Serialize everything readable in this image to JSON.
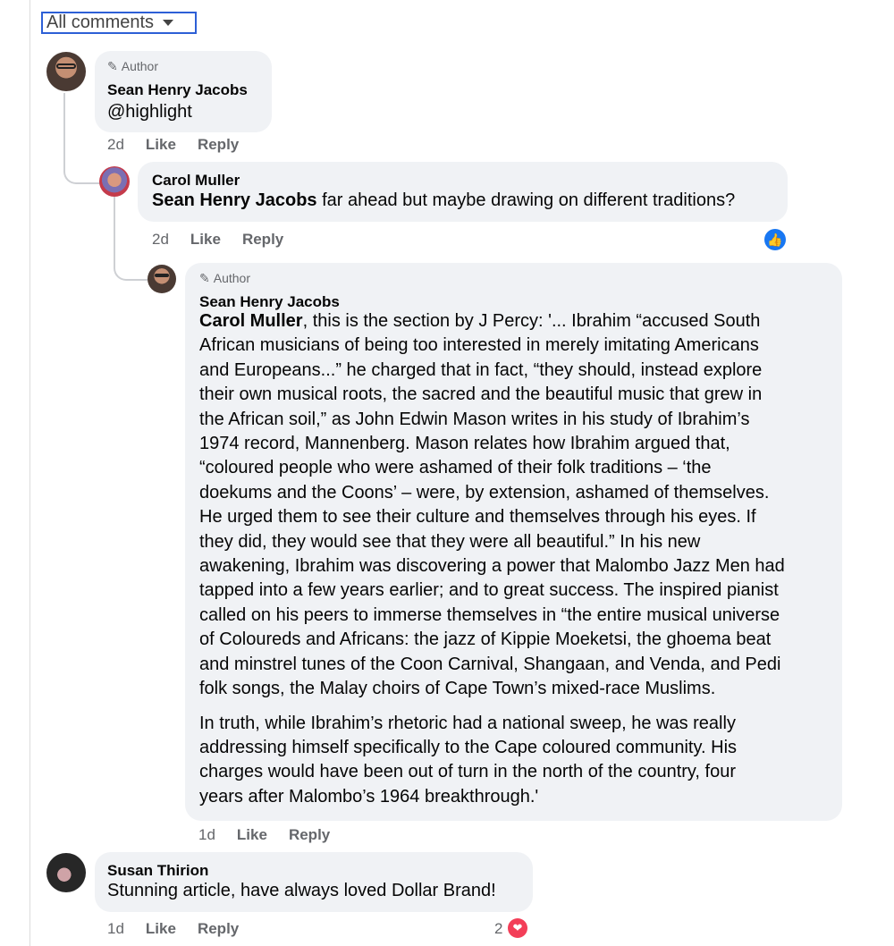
{
  "filter": {
    "label": "All comments"
  },
  "comments": [
    {
      "badge": "Author",
      "author": "Sean Henry Jacobs",
      "text": "@highlight",
      "time": "2d",
      "like": "Like",
      "reply": "Reply"
    },
    {
      "author": "Carol Muller",
      "mention": "Sean Henry Jacobs",
      "text": " far ahead but maybe drawing on different traditions?",
      "time": "2d",
      "like": "Like",
      "reply": "Reply",
      "reaction": "like-icon"
    },
    {
      "badge": "Author",
      "author": "Sean Henry Jacobs",
      "mention": "Carol Muller",
      "lines1": [
        ", this is the section by J Percy: '... Ibrahim “accused South",
        "African musicians of being too interested in merely imitating Americans",
        "and Europeans...” he charged that in fact, “they should, instead explore",
        "their own musical roots, the sacred and the beautiful music that grew in",
        "the African soil,” as John Edwin Mason writes in his study of Ibrahim’s",
        "1974 record, Mannenberg. Mason relates how Ibrahim argued that,",
        "“coloured people who were ashamed of their folk traditions – ‘the",
        "doekums and the Coons’ – were, by extension, ashamed of themselves.",
        "He urged them to see their culture and themselves through his eyes. If",
        "they did, they would see that they were all beautiful.” In his new",
        "awakening, Ibrahim was discovering a power that Malombo Jazz Men had",
        "tapped into a few years earlier; and to great success. The inspired pianist",
        "called on his peers to immerse themselves in “the entire musical universe",
        "of Coloureds and Africans: the jazz of Kippie Moeketsi, the ghoema beat",
        "and minstrel tunes of the Coon Carnival, Shangaan, and Venda, and Pedi",
        "folk songs, the Malay choirs of Cape Town’s mixed-race Muslims."
      ],
      "lines2": [
        "In truth, while Ibrahim’s rhetoric had a national sweep, he was really",
        "addressing himself specifically to the Cape coloured community. His",
        "charges would have been out of turn in the north of the country, four",
        "years after Malombo’s 1964 breakthrough.'"
      ],
      "time": "1d",
      "like": "Like",
      "reply": "Reply"
    },
    {
      "author": "Susan Thirion",
      "text": "Stunning article, have always loved Dollar Brand!",
      "time": "1d",
      "like": "Like",
      "reply": "Reply",
      "reaction_count": "2",
      "reaction": "heart-icon"
    }
  ],
  "colors": {
    "bubble": "#f0f2f5",
    "link_blue": "#1877f2",
    "heart": "#f33e58",
    "filter_border": "#2d5fd6"
  }
}
